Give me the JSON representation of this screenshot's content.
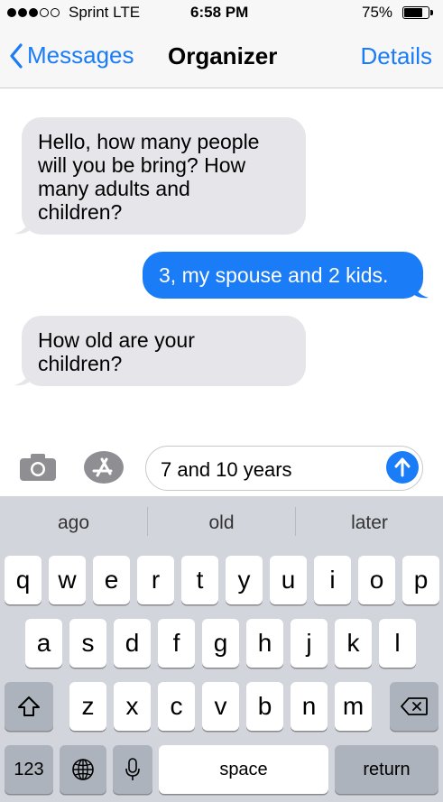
{
  "status_bar": {
    "carrier": "Sprint  LTE",
    "time": "6:58 PM",
    "battery_percent": "75%",
    "battery_level": 0.75,
    "signal_dots_filled": 3,
    "signal_dots_total": 5
  },
  "nav": {
    "back_label": "Messages",
    "title": "Organizer",
    "details_label": "Details"
  },
  "messages": [
    {
      "direction": "incoming",
      "lines": [
        "Hello, how many people",
        "will you be bring? How",
        "many adults and",
        "children?"
      ]
    },
    {
      "direction": "outgoing",
      "lines": [
        "3, my spouse and 2 kids."
      ]
    },
    {
      "direction": "incoming",
      "lines": [
        "How old are your",
        "children?"
      ]
    }
  ],
  "compose": {
    "value": "7 and 10 years"
  },
  "keyboard": {
    "suggestions": [
      "ago",
      "old",
      "later"
    ],
    "row1": [
      "q",
      "w",
      "e",
      "r",
      "t",
      "y",
      "u",
      "i",
      "o",
      "p"
    ],
    "row2": [
      "a",
      "s",
      "d",
      "f",
      "g",
      "h",
      "j",
      "k",
      "l"
    ],
    "row3": [
      "z",
      "x",
      "c",
      "v",
      "b",
      "n",
      "m"
    ],
    "numbers_label": "123",
    "space_label": "space",
    "return_label": "return"
  },
  "colors": {
    "accent": "#1a7cf6",
    "incoming_bubble": "#e5e5ea",
    "keyboard_bg": "#d2d5db"
  },
  "icons": [
    "back-chevron-icon",
    "camera-icon",
    "app-store-icon",
    "send-arrow-icon",
    "shift-icon",
    "backspace-icon",
    "globe-icon",
    "microphone-icon"
  ]
}
